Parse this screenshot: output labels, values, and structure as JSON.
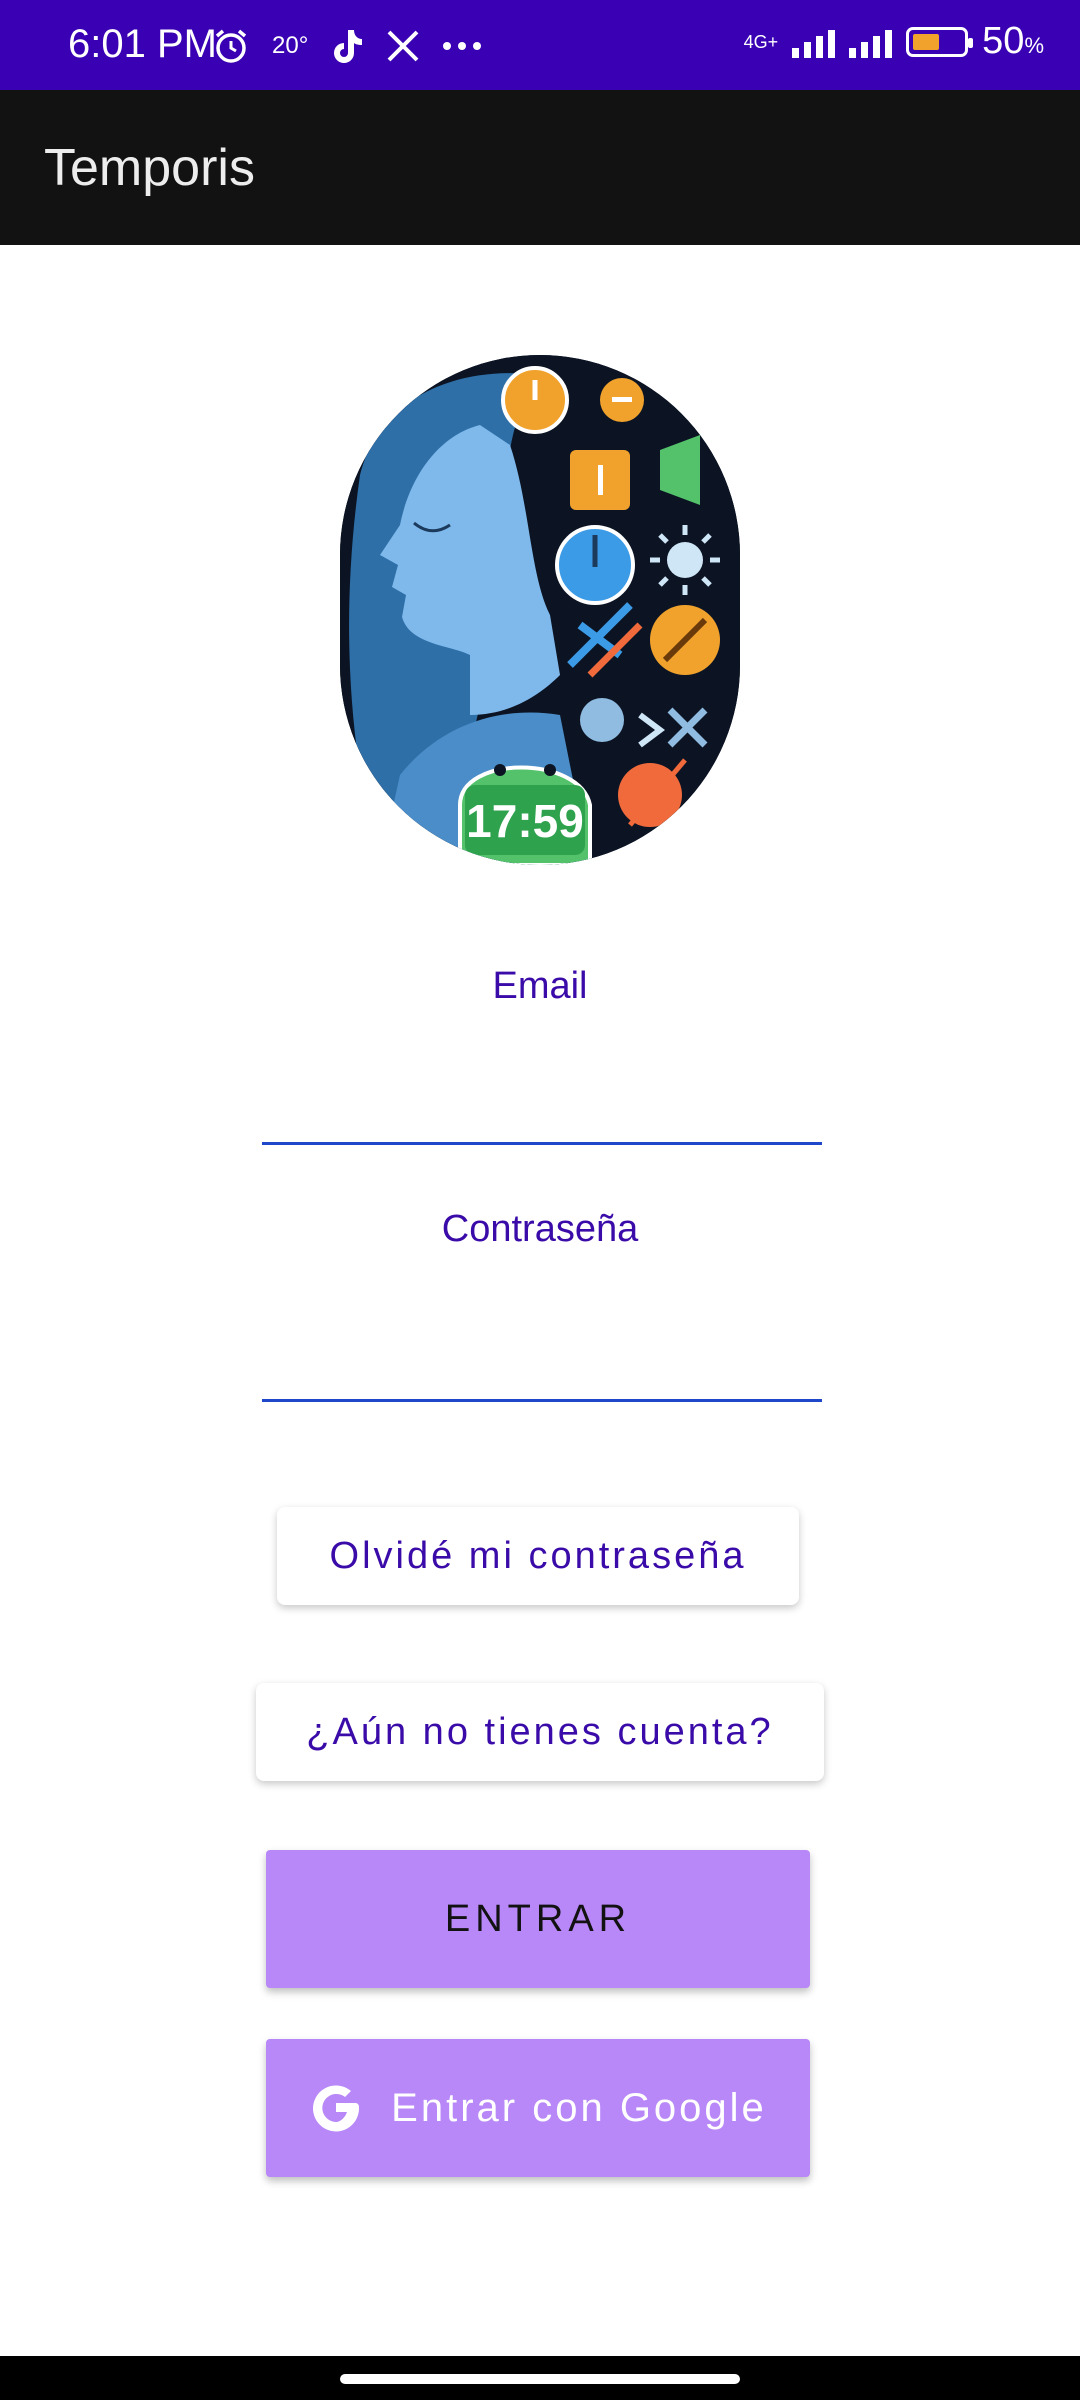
{
  "status_bar": {
    "time": "6:01 PM",
    "temperature": "20°",
    "network": "4G+",
    "battery_level": 0.5,
    "battery_text": "50",
    "battery_unit": "%",
    "icons": [
      "alarm-icon",
      "tiktok-icon",
      "x-icon",
      "more-dots-icon",
      "signal-icon",
      "battery-icon"
    ],
    "background": "#3A00B3"
  },
  "app_bar": {
    "title": "Temporis",
    "background": "#121212"
  },
  "logo": {
    "clock_text": "17:59"
  },
  "form": {
    "email_label": "Email",
    "email_value": "",
    "password_label": "Contraseña",
    "password_value": ""
  },
  "buttons": {
    "forgot_password": "Olvidé mi contraseña",
    "no_account": "¿Aún no tienes cuenta?",
    "enter": "ENTRAR",
    "google": "Entrar con Google"
  },
  "colors": {
    "accent_text": "#3A0BA8",
    "button_fill": "#B887F8",
    "input_underline": "#1E47C9"
  }
}
